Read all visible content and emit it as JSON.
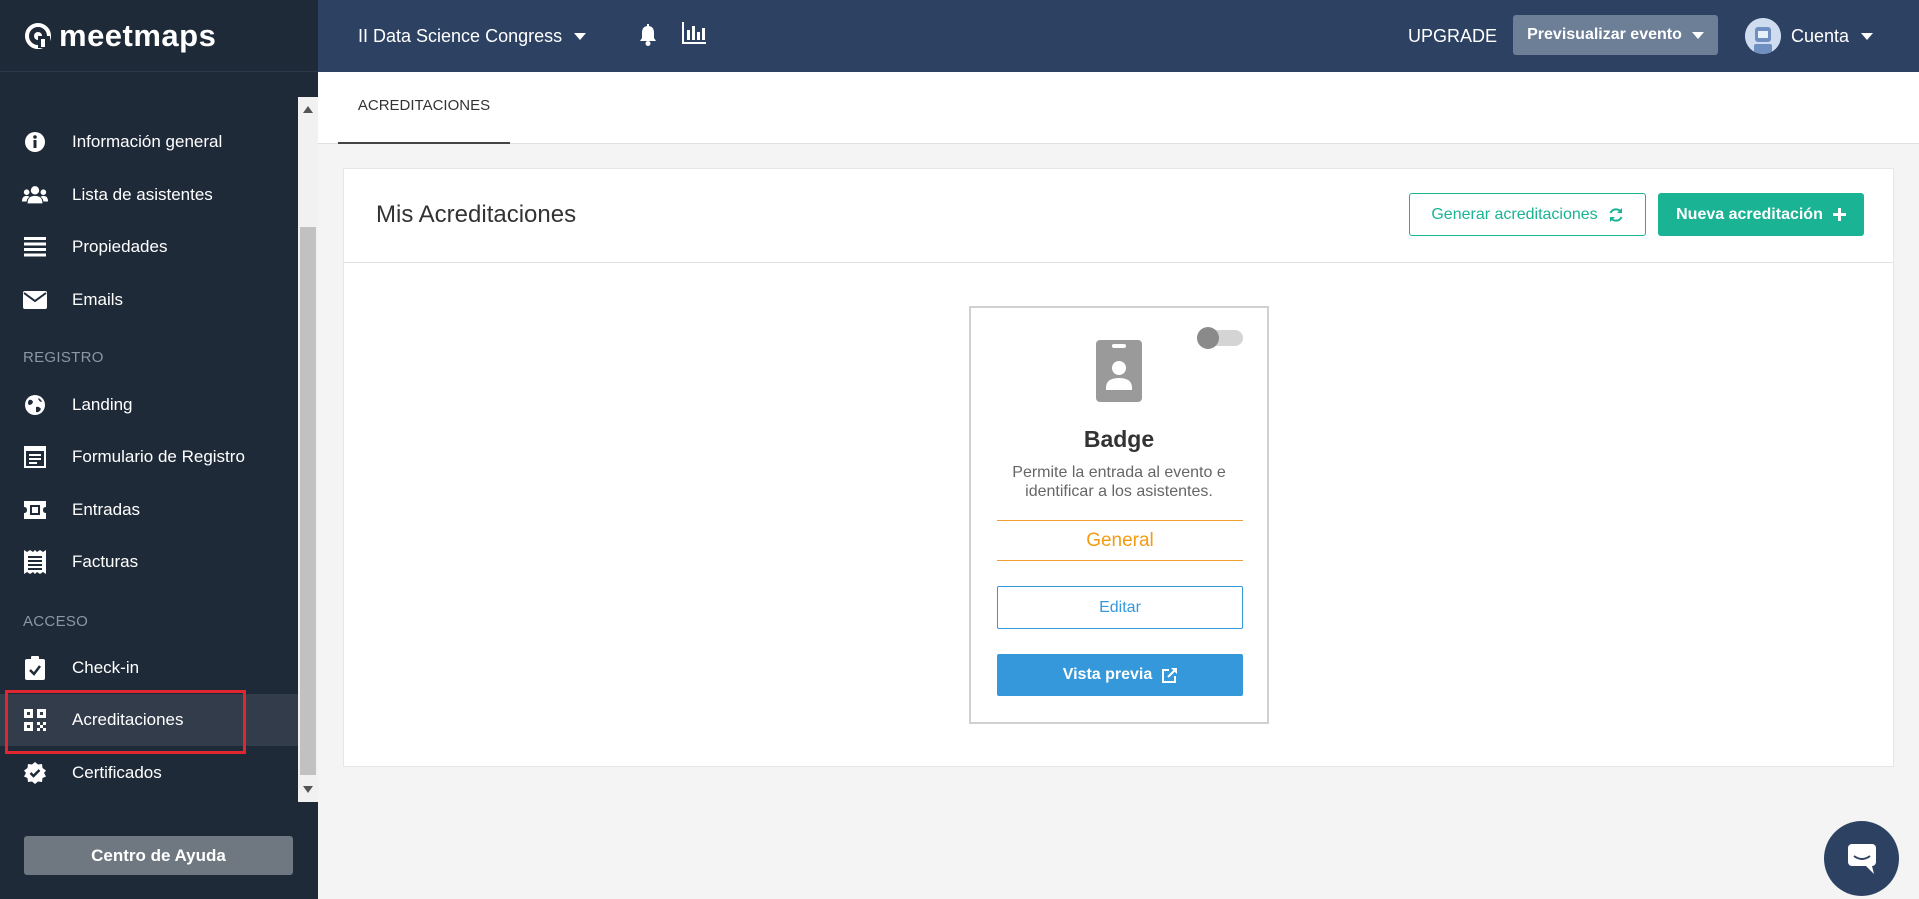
{
  "brand": {
    "name": "meetmaps"
  },
  "sidebar": {
    "items_top": [
      {
        "label": "Información general",
        "icon": "info-icon"
      },
      {
        "label": "Lista de asistentes",
        "icon": "users-icon"
      },
      {
        "label": "Propiedades",
        "icon": "list-icon"
      },
      {
        "label": "Emails",
        "icon": "envelope-icon"
      }
    ],
    "section_registro": "REGISTRO",
    "items_registro": [
      {
        "label": "Landing",
        "icon": "globe-icon"
      },
      {
        "label": "Formulario de Registro",
        "icon": "form-icon"
      },
      {
        "label": "Entradas",
        "icon": "ticket-icon"
      },
      {
        "label": "Facturas",
        "icon": "receipt-icon"
      }
    ],
    "section_acceso": "ACCESO",
    "items_acceso": [
      {
        "label": "Check-in",
        "icon": "clipboard-check-icon"
      },
      {
        "label": "Acreditaciones",
        "icon": "qr-icon",
        "active": true
      },
      {
        "label": "Certificados",
        "icon": "certificate-icon"
      }
    ],
    "help_button": "Centro de Ayuda"
  },
  "topnav": {
    "event_name": "II Data Science Congress",
    "upgrade": "UPGRADE",
    "preview_event": "Previsualizar evento",
    "account": "Cuenta"
  },
  "tabs": [
    {
      "label": "ACREDITACIONES",
      "active": true
    }
  ],
  "panel": {
    "title": "Mis Acreditaciones",
    "generate_button": "Generar acreditaciones",
    "new_button": "Nueva acreditación"
  },
  "badge": {
    "title": "Badge",
    "description": "Permite la entrada al evento e identificar a los asistentes.",
    "type": "General",
    "edit_button": "Editar",
    "preview_button": "Vista previa",
    "enabled": false
  },
  "colors": {
    "sidebar_bg": "#1f2a38",
    "topnav_bg": "#2d4263",
    "accent_green": "#1ab394",
    "accent_blue": "#3498db",
    "accent_orange": "#f39c12",
    "highlight_red": "#e0262e"
  }
}
